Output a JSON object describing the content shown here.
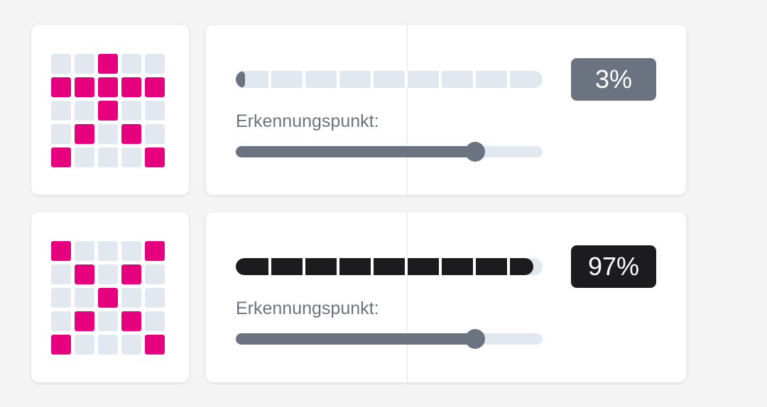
{
  "colors": {
    "pattern_on": "#e6007e",
    "pattern_off": "#e2e8f0",
    "low_badge": "#6b7280",
    "high_badge": "#1c1c1e",
    "slider": "#6b7280"
  },
  "rows": [
    {
      "pattern": [
        [
          0,
          0,
          1,
          0,
          0
        ],
        [
          1,
          1,
          1,
          1,
          1
        ],
        [
          0,
          0,
          1,
          0,
          0
        ],
        [
          0,
          1,
          0,
          1,
          0
        ],
        [
          1,
          0,
          0,
          0,
          1
        ]
      ],
      "confidence_text": "3%",
      "confidence_value": 0.03,
      "threshold_label": "Erkennungspunkt:",
      "threshold_value": 0.78
    },
    {
      "pattern": [
        [
          1,
          0,
          0,
          0,
          1
        ],
        [
          0,
          1,
          0,
          1,
          0
        ],
        [
          0,
          0,
          1,
          0,
          0
        ],
        [
          0,
          1,
          0,
          1,
          0
        ],
        [
          1,
          0,
          0,
          0,
          1
        ]
      ],
      "confidence_text": "97%",
      "confidence_value": 0.97,
      "threshold_label": "Erkennungspunkt:",
      "threshold_value": 0.78
    }
  ]
}
